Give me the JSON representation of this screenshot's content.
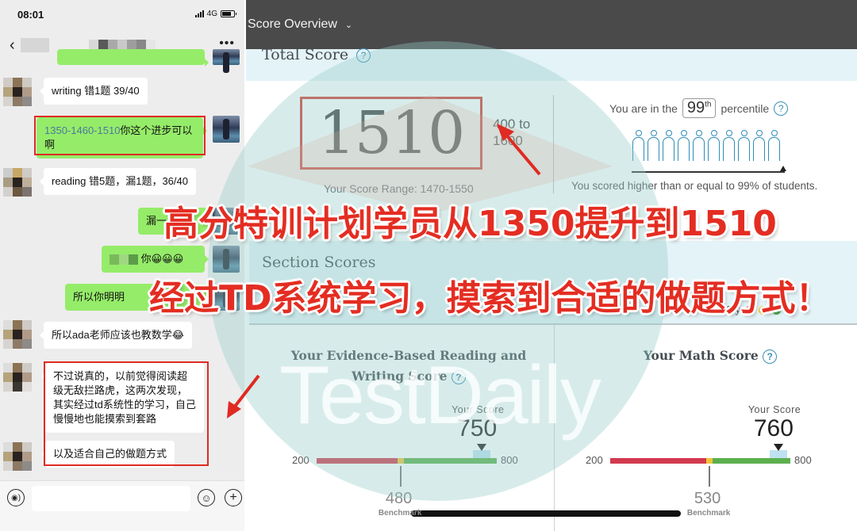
{
  "phone": {
    "status": {
      "time": "08:01",
      "network": "4G"
    },
    "nav": {
      "back_icon": "‹",
      "more_icon": "•••"
    },
    "messages": [
      {
        "side": "left",
        "text": "writing 错1题 39/40"
      },
      {
        "side": "right",
        "text_highlight": "1350-1460-1510",
        "text": "你这个进步可以啊"
      },
      {
        "side": "left",
        "text": "reading 错5题，漏1题，36/40"
      },
      {
        "side": "right",
        "text": "漏一"
      },
      {
        "side": "right",
        "text": "你😀😀😀"
      },
      {
        "side": "right",
        "text": "所以你明明"
      },
      {
        "side": "left",
        "text": "所以ada老师应该也教数学😂"
      },
      {
        "side": "left",
        "text": "不过说真的，以前觉得阅读超级无敌拦路虎，这两次发现，其实经过td系统性的学习，自己慢慢地也能摸索到套路"
      },
      {
        "side": "left",
        "text": "以及适合自己的做题方式"
      }
    ],
    "input": {
      "placeholder": ""
    }
  },
  "report": {
    "header": {
      "title": "Score Overview",
      "chevron": "⌄"
    },
    "total": {
      "title": "Total Score",
      "score": "1510",
      "range_note": "400 to 1600",
      "score_range": "Your Score Range: 1470-1550",
      "percentile_prefix": "You are in the",
      "percentile": "99",
      "percentile_suffix_sup": "th",
      "percentile_suffix": "percentile",
      "percentile_sentence": "You scored higher than or equal to 99% of students.",
      "people_count": 10
    },
    "sections": {
      "title": "Section Scores",
      "score_key_label": "Score Key",
      "key_colors": [
        "#d8344a",
        "#f2c230",
        "#4caf50"
      ],
      "panels": [
        {
          "title_line1": "Your Evidence-Based Reading and",
          "title_line2": "Writing Score",
          "your_score_label": "Your Score",
          "score": 750,
          "min": 200,
          "max": 800,
          "benchmark": 480,
          "benchmark_label": "Benchmark"
        },
        {
          "title_line1": "Your Math Score",
          "title_line2": "",
          "your_score_label": "Your Score",
          "score": 760,
          "min": 200,
          "max": 800,
          "benchmark": 530,
          "benchmark_label": "Benchmark"
        }
      ]
    },
    "bar_colors": {
      "below": "#d23a4e",
      "near": "#f0c33c",
      "above": "#5cb04f"
    }
  },
  "overlay": {
    "caption_line1": "高分特训计划学员从1350提升到1510",
    "caption_line2": "经过TD系统学习，摸索到合适的做题方式！",
    "watermark": "TestDaily"
  }
}
